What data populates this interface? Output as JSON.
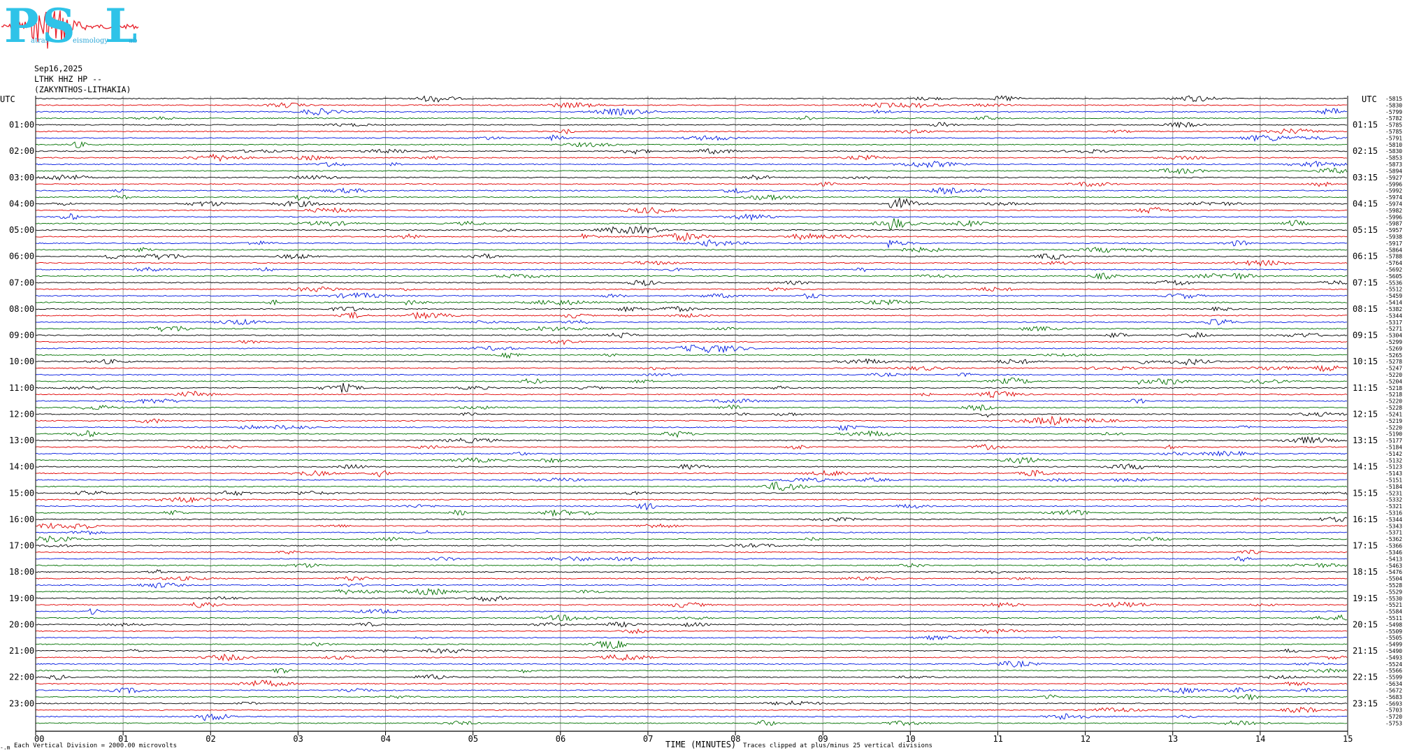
{
  "logo": {
    "letters": [
      "P",
      "S",
      "L"
    ],
    "words": [
      "atras",
      "eismology",
      "ab"
    ],
    "accent_color": "#2fc3e8",
    "wave_color": "#e8202a"
  },
  "header": {
    "date": "Sep16,2025",
    "station": "LTHK HHZ HP --",
    "location": "(ZAKYNTHOS-LITHAKIA)"
  },
  "axes": {
    "left_unit": "UTC",
    "right_unit": "UTC",
    "xlabel": "TIME (MINUTES)",
    "scale_note": "Each Vertical Division = 2000.00 microvolts",
    "clip_note": "Traces clipped at plus/minus 25 vertical divisions",
    "corner_mark": "-.m"
  },
  "chart_data": {
    "type": "line",
    "title": "",
    "x_range": [
      0,
      15
    ],
    "x_ticks": [
      "00",
      "01",
      "02",
      "03",
      "04",
      "05",
      "06",
      "07",
      "08",
      "09",
      "10",
      "11",
      "12",
      "13",
      "14",
      "15"
    ],
    "trace_minutes": 15,
    "trace_count": 96,
    "color_cycle": [
      "#000000",
      "#e00000",
      "#0018e0",
      "#007000"
    ],
    "left_hour_labels": [
      "01:00",
      "02:00",
      "03:00",
      "04:00",
      "05:00",
      "06:00",
      "07:00",
      "08:00",
      "09:00",
      "10:00",
      "11:00",
      "12:00",
      "13:00",
      "14:00",
      "15:00",
      "16:00",
      "17:00",
      "18:00",
      "19:00",
      "20:00",
      "21:00",
      "22:00",
      "23:00"
    ],
    "right_hour_labels": [
      "01:15",
      "02:15",
      "03:15",
      "04:15",
      "05:15",
      "06:15",
      "07:15",
      "08:15",
      "09:15",
      "10:15",
      "11:15",
      "12:15",
      "13:15",
      "14:15",
      "15:15",
      "16:15",
      "17:15",
      "18:15",
      "19:15",
      "20:15",
      "21:15",
      "22:15",
      "23:15"
    ],
    "trace_offsets": [
      "-5815",
      "-5830",
      "-5799",
      "-5782",
      "-5785",
      "-5785",
      "-5791",
      "-5810",
      "-5830",
      "-5853",
      "-5873",
      "-5894",
      "-5927",
      "-5996",
      "-5992",
      "-5974",
      "-5974",
      "-5982",
      "-5996",
      "-5987",
      "-5957",
      "-5938",
      "-5917",
      "-5864",
      "-5788",
      "-5764",
      "-5692",
      "-5605",
      "-5536",
      "-5512",
      "-5459",
      "-5414",
      "-5382",
      "-5344",
      "-5317",
      "-5271",
      "-5304",
      "-5299",
      "-5269",
      "-5265",
      "-5278",
      "-5247",
      "-5220",
      "-5204",
      "-5218",
      "-5218",
      "-5220",
      "-5228",
      "-5241",
      "-5219",
      "-5220",
      "-5190",
      "-5177",
      "-5184",
      "-5142",
      "-5132",
      "-5123",
      "-5143",
      "-5151",
      "-5184",
      "-5231",
      "-5332",
      "-5321",
      "-5316",
      "-5344",
      "-5343",
      "-5371",
      "-5362",
      "-5366",
      "-5346",
      "-5413",
      "-5463",
      "-5476",
      "-5504",
      "-5528",
      "-5529",
      "-5530",
      "-5521",
      "-5584",
      "-5511",
      "-5498",
      "-5509",
      "-5505",
      "-5499",
      "-5490",
      "-5493",
      "-5524",
      "-5566",
      "-5599",
      "-5634",
      "-5672",
      "-5683",
      "-5693",
      "-5703",
      "-5720",
      "-5753"
    ],
    "events": [
      {
        "trace": 16,
        "minute": 9.78,
        "amp": 22
      },
      {
        "trace": 19,
        "minute": 9.78,
        "amp": 10
      },
      {
        "trace": 21,
        "minute": 6.25,
        "amp": 5
      },
      {
        "trace": 22,
        "minute": 9.75,
        "amp": 6
      },
      {
        "trace": 31,
        "minute": 4.25,
        "amp": 4
      },
      {
        "trace": 33,
        "minute": 4.3,
        "amp": 3
      },
      {
        "trace": 50,
        "minute": 9.2,
        "amp": 6
      },
      {
        "trace": 44,
        "minute": 3.5,
        "amp": 4
      },
      {
        "trace": 43,
        "minute": 12.6,
        "amp": 4
      },
      {
        "trace": 53,
        "minute": 12.9,
        "amp": 4
      },
      {
        "trace": 84,
        "minute": 14.3,
        "amp": 3
      }
    ]
  }
}
